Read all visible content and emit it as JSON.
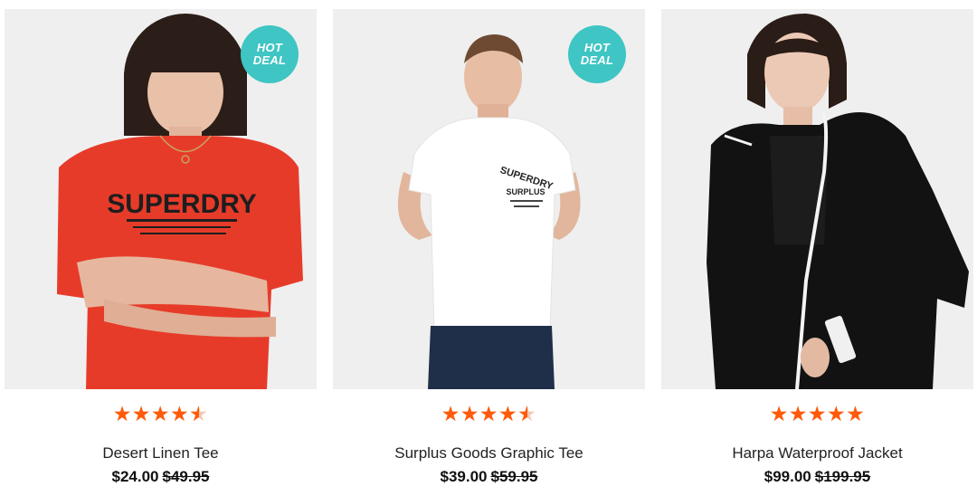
{
  "products": [
    {
      "name": "Desert Linen Tee",
      "price": "$24.00",
      "old_price": "$49.95",
      "rating": 4.5,
      "badge": "HOT DEAL",
      "garment_color": "#e73b2a"
    },
    {
      "name": "Surplus Goods Graphic Tee",
      "price": "$39.00",
      "old_price": "$59.95",
      "rating": 4.5,
      "badge": "HOT DEAL",
      "garment_color": "#ffffff"
    },
    {
      "name": "Harpa Waterproof Jacket",
      "price": "$99.00",
      "old_price": "$199.95",
      "rating": 5,
      "badge": "",
      "garment_color": "#111111"
    }
  ],
  "print_texts": {
    "tee1_logo": "SUPERDRY",
    "tee2_logo_line1": "SUPERDRY",
    "tee2_logo_line2": "SURPLUS"
  },
  "colors": {
    "badge": "#3fc5c3",
    "star": "#ff5a0a",
    "background": "#efefef"
  }
}
